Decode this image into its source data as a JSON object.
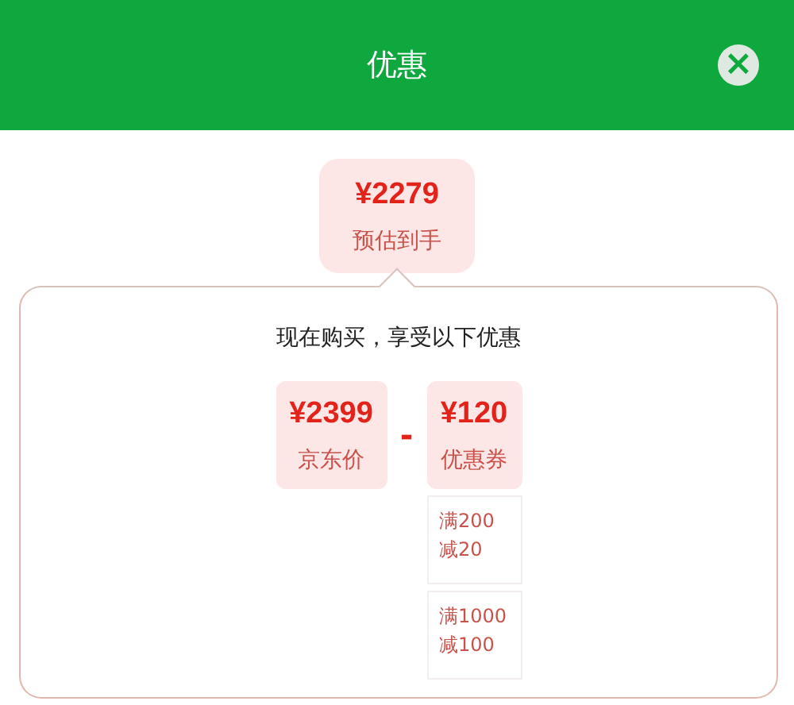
{
  "header": {
    "title": "优惠",
    "close": "×"
  },
  "estimate": {
    "price": "¥2279",
    "label": "预估到手"
  },
  "intro": "现在购买，享受以下优惠",
  "jd_price": {
    "price": "¥2399",
    "label": "京东价"
  },
  "operator": "-",
  "coupon": {
    "price": "¥120",
    "label": "优惠券"
  },
  "coupon_rules": [
    {
      "lines": [
        "满200",
        "减20"
      ]
    },
    {
      "lines": [
        "满1000",
        "减100"
      ]
    }
  ]
}
